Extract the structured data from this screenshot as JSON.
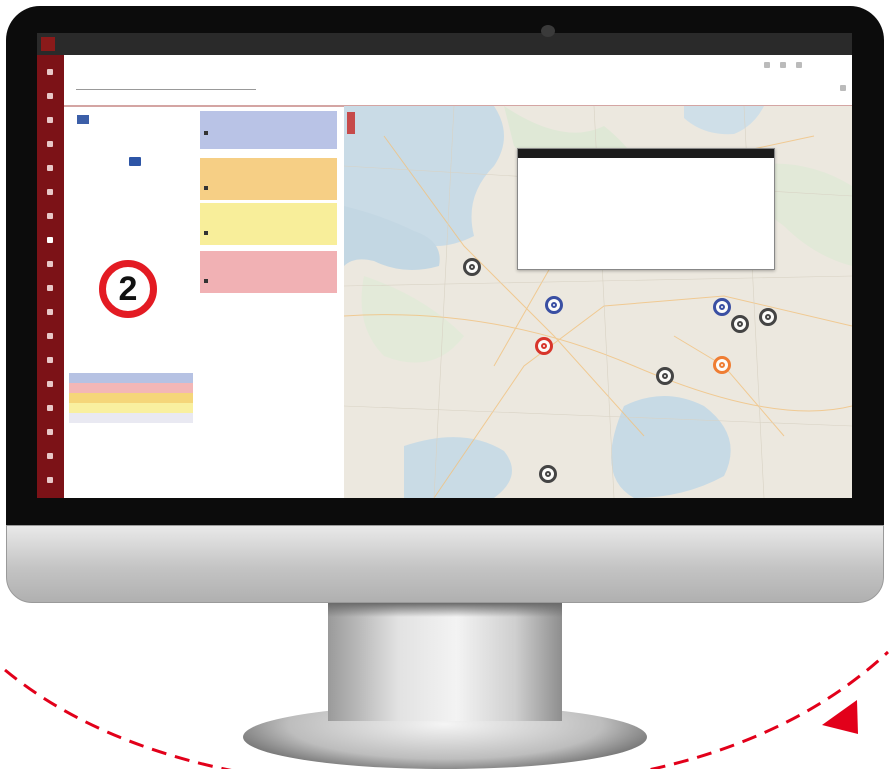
{
  "app": {
    "brand_label": "",
    "module_label": "",
    "top_right_link": "",
    "back_link": "",
    "page_title": "",
    "user_menu_label": ""
  },
  "calendar": {
    "month_label": "",
    "today_button": "",
    "weekday_headers": [
      "",
      "",
      "",
      "",
      "",
      "",
      ""
    ],
    "selected_day": ""
  },
  "counter": {
    "label": "",
    "value": "2",
    "ring_color": "#e31b23"
  },
  "legend": {
    "title": "",
    "items": [
      {
        "label": "",
        "color": "#b6c2e3"
      },
      {
        "label": "",
        "color": "#f3b7b7"
      },
      {
        "label": "",
        "color": "#f5d67a"
      },
      {
        "label": "",
        "color": "#f9f0a0"
      },
      {
        "label": "",
        "color": "#e9e9f2"
      }
    ]
  },
  "cards": [
    {
      "color": "#b9c3e6",
      "lines": [
        "",
        "",
        ""
      ]
    },
    {
      "color": "#f6cf85",
      "lines": [
        "",
        "",
        "",
        ""
      ]
    },
    {
      "color": "#f8ee9a",
      "lines": [
        "",
        "",
        "",
        ""
      ]
    },
    {
      "color": "#f1b1b4",
      "lines": [
        "",
        "",
        "",
        ""
      ]
    }
  ],
  "map": {
    "toolbar_label": "",
    "popup": {
      "title": "",
      "lines": [
        "",
        "",
        "",
        "",
        "",
        "",
        "",
        "",
        ""
      ]
    },
    "attribution": "",
    "markers": [
      {
        "name": "marker-gray-1",
        "color": "#444444"
      },
      {
        "name": "marker-blue-1",
        "color": "#3a4fa3"
      },
      {
        "name": "marker-red-1",
        "color": "#d8352b"
      },
      {
        "name": "marker-blue-2",
        "color": "#3a4fa3"
      },
      {
        "name": "marker-gray-2",
        "color": "#444444"
      },
      {
        "name": "marker-gray-3",
        "color": "#444444"
      },
      {
        "name": "marker-orange-1",
        "color": "#ef7d33"
      },
      {
        "name": "marker-gray-4",
        "color": "#444444"
      },
      {
        "name": "marker-gray-5",
        "color": "#444444"
      }
    ]
  },
  "decor": {
    "accent": "#e2001a",
    "sidebar_color": "#7c1217"
  }
}
